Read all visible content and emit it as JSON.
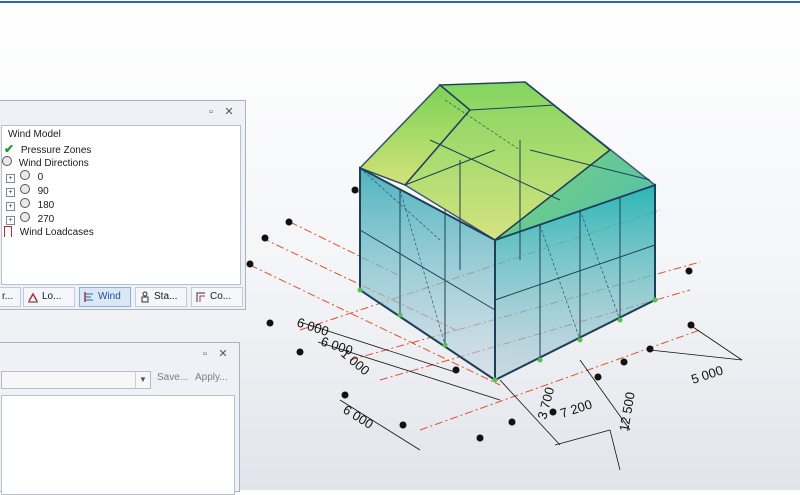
{
  "wind_panel": {
    "tree": {
      "root": "Wind Model",
      "pressure_zones": "Pressure Zones",
      "wind_directions": "Wind Directions",
      "directions": [
        "0",
        "90",
        "180",
        "270"
      ],
      "wind_loadcases": "Wind Loadcases"
    },
    "tabs": [
      "r...",
      "Lo...",
      "Wind",
      "Sta...",
      "Co..."
    ],
    "active_tab": "Wind"
  },
  "apply_panel": {
    "save_label": "Save...",
    "apply_label": "Apply..."
  },
  "viewport": {
    "dimensions": [
      "6 000",
      "6 000",
      "1 000",
      "6 000",
      "3 700",
      "7 200",
      "12 500",
      "5 000"
    ]
  },
  "colors": {
    "accent": "#2d64b0",
    "frame": "#1d3f5a",
    "axis": "#e0522a",
    "glass_top": "#7fd24a",
    "glass_bottom": "#2aa6b5"
  }
}
